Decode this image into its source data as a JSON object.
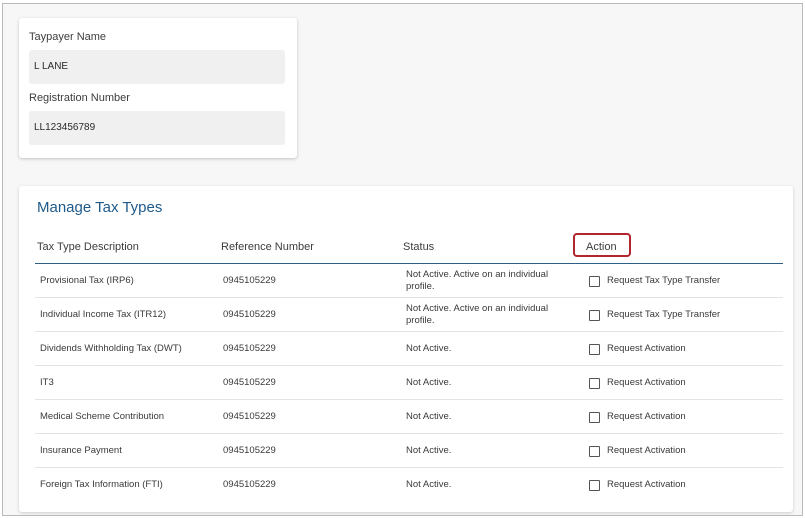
{
  "taxpayer": {
    "name_label": "Taypayer Name",
    "name_value": "L LANE",
    "registration_label": "Registration Number",
    "registration_value": "LL123456789"
  },
  "manage": {
    "title": "Manage Tax Types",
    "columns": {
      "description": "Tax Type Description",
      "reference": "Reference Number",
      "status": "Status",
      "action": "Action"
    },
    "rows": [
      {
        "description": "Provisional Tax (IRP6)",
        "reference": "0945105229",
        "status": "Not Active. Active on an individual profile.",
        "action": "Request Tax Type Transfer"
      },
      {
        "description": "Individual Income Tax (ITR12)",
        "reference": "0945105229",
        "status": "Not Active. Active on an individual profile.",
        "action": "Request Tax Type Transfer"
      },
      {
        "description": "Dividends Withholding Tax (DWT)",
        "reference": "0945105229",
        "status": "Not Active.",
        "action": "Request Activation"
      },
      {
        "description": "IT3",
        "reference": "0945105229",
        "status": "Not Active.",
        "action": "Request Activation"
      },
      {
        "description": "Medical Scheme Contribution",
        "reference": "0945105229",
        "status": "Not Active.",
        "action": "Request Activation"
      },
      {
        "description": "Insurance Payment",
        "reference": "0945105229",
        "status": "Not Active.",
        "action": "Request Activation"
      },
      {
        "description": "Foreign Tax Information (FTI)",
        "reference": "0945105229",
        "status": "Not Active.",
        "action": "Request Activation"
      }
    ]
  },
  "colors": {
    "title": "#1e5a8a",
    "highlight_border": "#b0272e",
    "header_line": "#2d5f86"
  }
}
